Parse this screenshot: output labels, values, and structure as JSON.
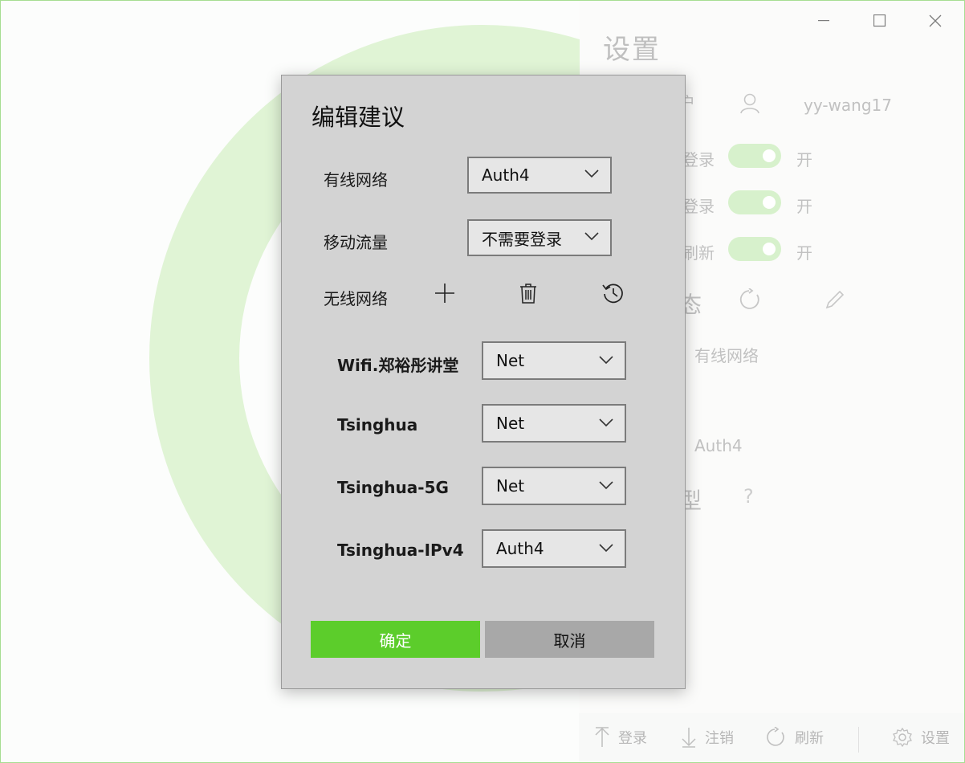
{
  "window": {
    "controls": [
      "minimize",
      "maximize",
      "close"
    ]
  },
  "background_settings": {
    "title": "设置",
    "username_partial": "户",
    "username": "yy-wang17",
    "toggles": [
      {
        "label_partial": "登录",
        "state": "开"
      },
      {
        "label_partial": "登录",
        "state": "开"
      },
      {
        "label_partial": "刷新",
        "state": "开"
      }
    ],
    "status_partial": "态",
    "wired_value": "有线网络",
    "auth_value": "Auth4",
    "type_partial": "型",
    "question_mark": "?",
    "stray_dot": "·"
  },
  "bottom_bar": {
    "login": "登录",
    "logout": "注销",
    "refresh": "刷新",
    "settings": "设置"
  },
  "dialog": {
    "title": "编辑建议",
    "wired_label": "有线网络",
    "wired_value": "Auth4",
    "mobile_label": "移动流量",
    "mobile_value": "不需要登录",
    "wireless_label": "无线网络",
    "wireless_rows": [
      {
        "ssid": "Wifi.郑裕彤讲堂",
        "value": "Net"
      },
      {
        "ssid": "Tsinghua",
        "value": "Net"
      },
      {
        "ssid": "Tsinghua-5G",
        "value": "Net"
      },
      {
        "ssid": "Tsinghua-IPv4",
        "value": "Auth4"
      }
    ],
    "ok_label": "确定",
    "cancel_label": "取消"
  }
}
